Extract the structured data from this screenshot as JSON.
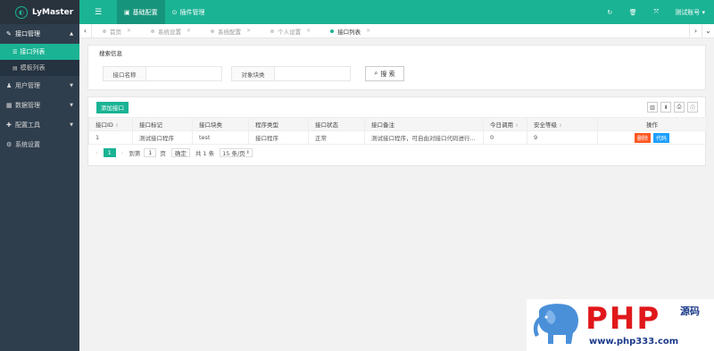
{
  "app": {
    "title": "LyMaster"
  },
  "sidebar": {
    "menus": [
      {
        "label": "接口管理",
        "open": true,
        "children": [
          {
            "label": "接口列表",
            "active": true
          },
          {
            "label": "模板列表",
            "active": false
          }
        ]
      },
      {
        "label": "用户管理",
        "open": false
      },
      {
        "label": "数据管理",
        "open": false
      },
      {
        "label": "配置工具",
        "open": false
      },
      {
        "label": "系统设置",
        "open": false
      }
    ]
  },
  "topbar": {
    "tabs": [
      {
        "label": "基础配置",
        "active": true
      },
      {
        "label": "插件管理",
        "active": false
      }
    ],
    "account": "测试账号"
  },
  "tabbar": {
    "tabs": [
      {
        "label": "首页"
      },
      {
        "label": "系统设置"
      },
      {
        "label": "系统配置"
      },
      {
        "label": "个人设置"
      },
      {
        "label": "接口列表",
        "active": true
      }
    ]
  },
  "search": {
    "legend": "搜索信息",
    "fields": [
      {
        "label": "接口名称",
        "value": ""
      },
      {
        "label": "对象块类",
        "value": ""
      }
    ],
    "button": "搜 索"
  },
  "table": {
    "add_button": "添加接口",
    "columns": [
      "接口ID",
      "接口标记",
      "接口块类",
      "程序类型",
      "接口状态",
      "接口备注",
      "今日调用",
      "安全等级",
      "操作"
    ],
    "rows": [
      [
        "1",
        "测试接口程序",
        "test",
        "接口程序",
        "正常",
        "测试接口程序，可自由对接口代码进行...",
        "0",
        "9"
      ]
    ],
    "row_actions": {
      "delete": "删除",
      "code": "代码"
    }
  },
  "pager": {
    "current": "1",
    "goto_label": "到第",
    "goto_value": "1",
    "page_unit": "页",
    "confirm": "确定",
    "total": "共 1 条",
    "page_size": "15 条/页"
  },
  "watermark": {
    "brand": "PHP",
    "sub": "源码",
    "url": "www.php333.com"
  },
  "colors": {
    "primary": "#1ab394",
    "sidebar": "#2f3e4d",
    "danger": "#ff5722",
    "info": "#1e9fff"
  }
}
